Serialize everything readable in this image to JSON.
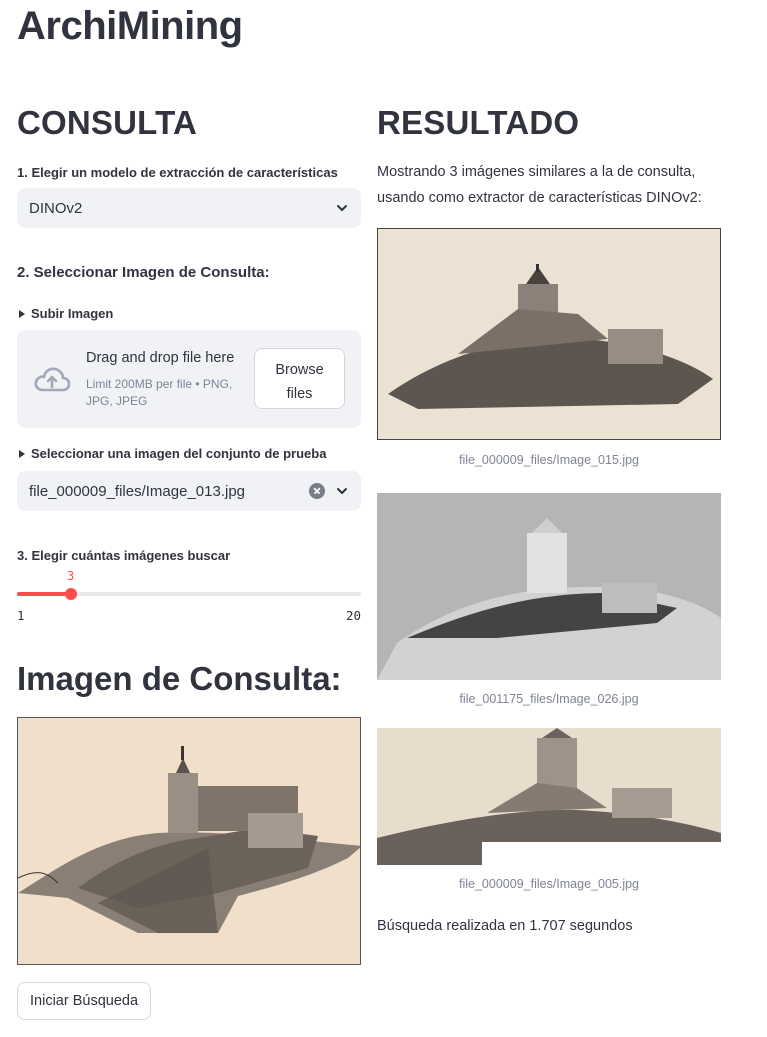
{
  "app": {
    "title": "ArchiMining"
  },
  "consulta": {
    "heading": "CONSULTA",
    "step1_label": "1. Elegir un modelo de extracción de características",
    "model_select": {
      "value": "DINOv2"
    },
    "step2_heading": "2. Seleccionar Imagen de Consulta:",
    "upload_expander": {
      "label": "Subir Imagen"
    },
    "uploader": {
      "title": "Drag and drop file here",
      "subtitle": "Limit 200MB per file • PNG, JPG, JPEG",
      "browse_label_line1": "Browse",
      "browse_label_line2": "files"
    },
    "testset_expander": {
      "label": "Seleccionar una imagen del conjunto de prueba"
    },
    "testset_select": {
      "value": "file_000009_files/Image_013.jpg"
    },
    "step3_label": "3. Elegir cuántas imágenes buscar",
    "slider": {
      "value": 3,
      "min": 1,
      "max": 20,
      "value_label": "3",
      "min_label": "1",
      "max_label": "20",
      "color": "#ff4b4b"
    },
    "query_heading": "Imagen de Consulta:",
    "search_button": "Iniciar Búsqueda"
  },
  "resultado": {
    "heading": "RESULTADO",
    "description": "Mostrando 3 imágenes similares a la de consulta, usando como extractor de características DINOv2:",
    "results": [
      {
        "caption": "file_000009_files/Image_015.jpg"
      },
      {
        "caption": "file_001175_files/Image_026.jpg"
      },
      {
        "caption": "file_000009_files/Image_005.jpg"
      }
    ],
    "timing": "Búsqueda realizada en 1.707 segundos"
  },
  "icons": {
    "upload": "cloud-upload-icon",
    "chevron": "chevron-down-icon",
    "clear": "clear-icon",
    "expander": "triangle-right-icon"
  }
}
